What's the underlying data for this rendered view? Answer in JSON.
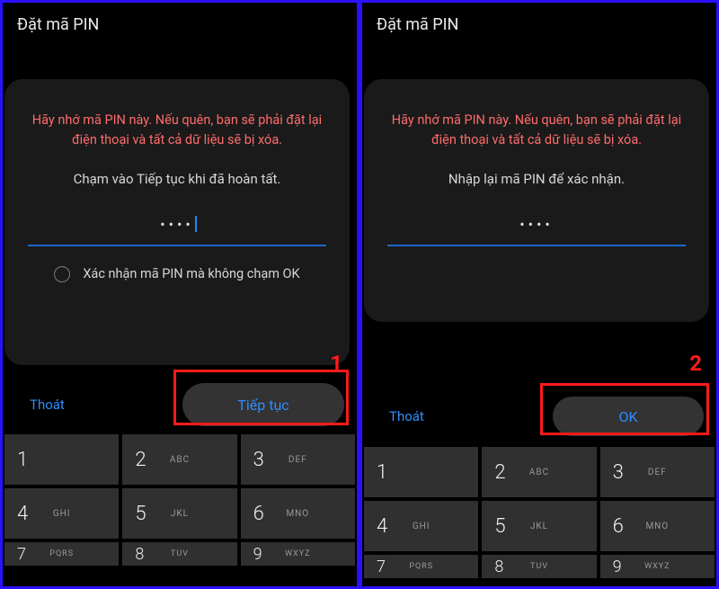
{
  "left": {
    "title": "Đặt mã PIN",
    "warning": "Hãy nhớ mã PIN này. Nếu quên, bạn sẽ phải đặt lại điện thoại và tất cả dữ liệu sẽ bị xóa.",
    "instruction": "Chạm vào Tiếp tục khi đã hoàn tất.",
    "pin_dots": "••••",
    "confirm_no_ok": "Xác nhận mã PIN mà không chạm OK",
    "step": "1",
    "exit": "Thoát",
    "primary": "Tiếp tục"
  },
  "right": {
    "title": "Đặt mã PIN",
    "warning": "Hãy nhớ mã PIN này. Nếu quên, bạn sẽ phải đặt lại điện thoại và tất cả dữ liệu sẽ bị xóa.",
    "instruction": "Nhập lại mã PIN để xác nhận.",
    "pin_dots": "••••",
    "step": "2",
    "exit": "Thoát",
    "primary": "OK"
  },
  "keypad": {
    "r1": [
      {
        "n": "1",
        "l": ""
      },
      {
        "n": "2",
        "l": "ABC"
      },
      {
        "n": "3",
        "l": "DEF"
      }
    ],
    "r2": [
      {
        "n": "4",
        "l": "GHI"
      },
      {
        "n": "5",
        "l": "JKL"
      },
      {
        "n": "6",
        "l": "MNO"
      }
    ],
    "r3": [
      {
        "n": "7",
        "l": "PQRS"
      },
      {
        "n": "8",
        "l": "TUV"
      },
      {
        "n": "9",
        "l": "WXYZ"
      }
    ]
  }
}
